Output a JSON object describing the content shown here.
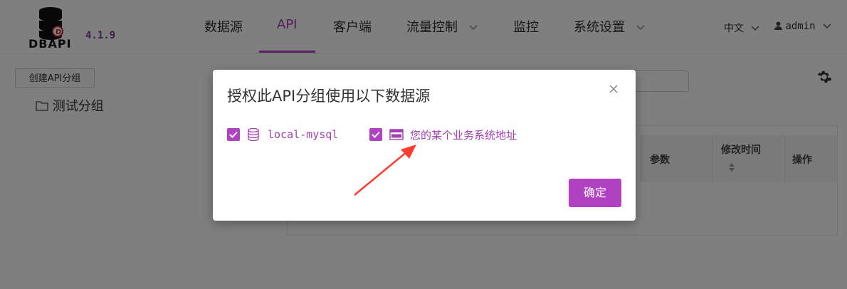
{
  "app": {
    "logo_text": "DBAPI",
    "version": "4.1.9"
  },
  "nav": {
    "items": [
      {
        "label": "数据源"
      },
      {
        "label": "API"
      },
      {
        "label": "客户端"
      },
      {
        "label": "流量控制"
      },
      {
        "label": "监控"
      },
      {
        "label": "系统设置"
      }
    ],
    "language": "中文",
    "user": "admin"
  },
  "sidebar": {
    "create_button": "创建API分组",
    "groups": [
      {
        "label": "测试分组"
      }
    ]
  },
  "table": {
    "headers": [
      {
        "label": "参数"
      },
      {
        "label": "修改时间"
      },
      {
        "label": "操作"
      }
    ]
  },
  "modal": {
    "title": "授权此API分组使用以下数据源",
    "options": [
      {
        "label": "local-mysql",
        "checked": true,
        "icon": "database-icon",
        "color": "#a33fb3"
      },
      {
        "label": "您的某个业务系统地址",
        "checked": true,
        "icon": "http-icon",
        "color": "#a33fb3"
      }
    ],
    "confirm_label": "确定"
  },
  "colors": {
    "accent": "#b041c0",
    "mask": "rgba(0,0,0,0.5)",
    "arrow": "#ff3b30"
  }
}
